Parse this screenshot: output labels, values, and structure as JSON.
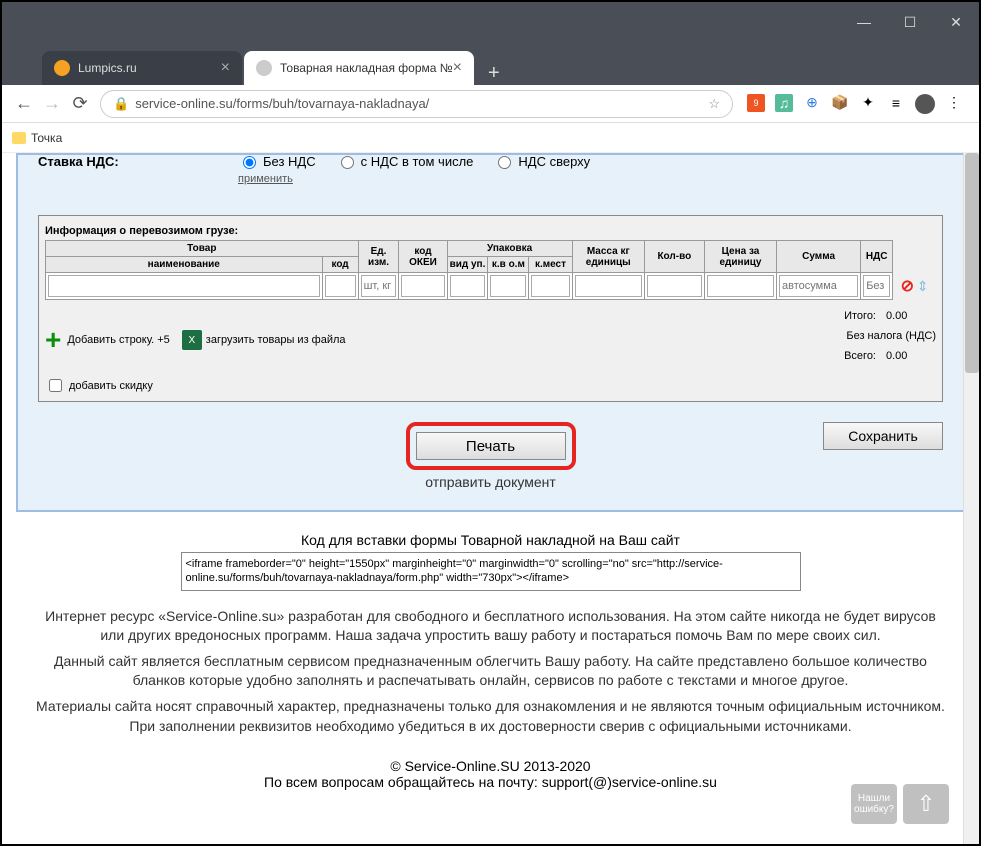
{
  "window": {
    "tabs": [
      {
        "label": "Lumpics.ru",
        "favicon_color": "#f5a122",
        "active": false
      },
      {
        "label": "Товарная накладная форма №",
        "favicon_color": "#999",
        "active": true
      }
    ]
  },
  "addressbar": {
    "url": "service-online.su/forms/buh/tovarnaya-nakladnaya/",
    "bookmark": "Точка"
  },
  "vat": {
    "label": "Ставка НДС:",
    "options": [
      "Без НДС",
      "с НДС в том числе",
      "НДС сверху"
    ],
    "selected": 0,
    "apply": "применить"
  },
  "cargo": {
    "title": "Информация о перевозимом грузе:",
    "headers": {
      "product": "Товар",
      "name": "наименование",
      "code": "код",
      "unit": "Ед. изм.",
      "okei": "код ОКЕИ",
      "package": "Упаковка",
      "pack_type": "вид уп.",
      "pack_in": "к.в о.м",
      "pack_places": "к.мест",
      "mass": "Масса кг единицы",
      "qty": "Кол-во",
      "price": "Цена за единицу",
      "sum": "Сумма",
      "nds": "НДС"
    },
    "row": {
      "unit_placeholder": "шт, кг",
      "sum_placeholder": "автосумма",
      "nds_placeholder": "Без"
    },
    "add_row": "Добавить строку. +5",
    "load_file": "загрузить товары из файла",
    "discount": "добавить скидку",
    "totals": {
      "itogo_label": "Итого:",
      "itogo_val": "0.00",
      "no_tax": "Без налога (НДС)",
      "vsego_label": "Всего:",
      "vsego_val": "0.00"
    }
  },
  "buttons": {
    "print": "Печать",
    "save": "Сохранить",
    "send": "отправить документ"
  },
  "embed": {
    "title": "Код для вставки формы Товарной накладной на Ваш сайт",
    "code": "<iframe frameborder=\"0\" height=\"1550px\" marginheight=\"0\" marginwidth=\"0\" scrolling=\"no\" src=\"http://service-online.su/forms/buh/tovarnaya-nakladnaya/form.php\" width=\"730px\"></iframe>"
  },
  "footer": {
    "p1": "Интернет ресурс «Service-Online.su» разработан для свободного и бесплатного использования. На этом сайте никогда не будет вирусов или других вредоносных программ. Наша задача упростить вашу работу и постараться помочь Вам по мере своих сил.",
    "p2": "Данный сайт является бесплатным сервисом предназначенным облегчить Вашу работу. На сайте представлено большое количество бланков которые удобно заполнять и распечатывать онлайн, сервисов по работе с текстами и многое другое.",
    "p3": "Материалы сайта носят справочный характер, предназначены только для ознакомления и не являются точным официальным источником. При заполнении реквизитов необходимо убедиться в их достоверности сверив с официальными источниками.",
    "copyright": "© Service-Online.SU 2013-2020",
    "contact": "По всем вопросам обращайтесь на почту: support(@)service-online.su"
  },
  "float": {
    "help": "Нашли ошибку?",
    "up": "↑"
  }
}
